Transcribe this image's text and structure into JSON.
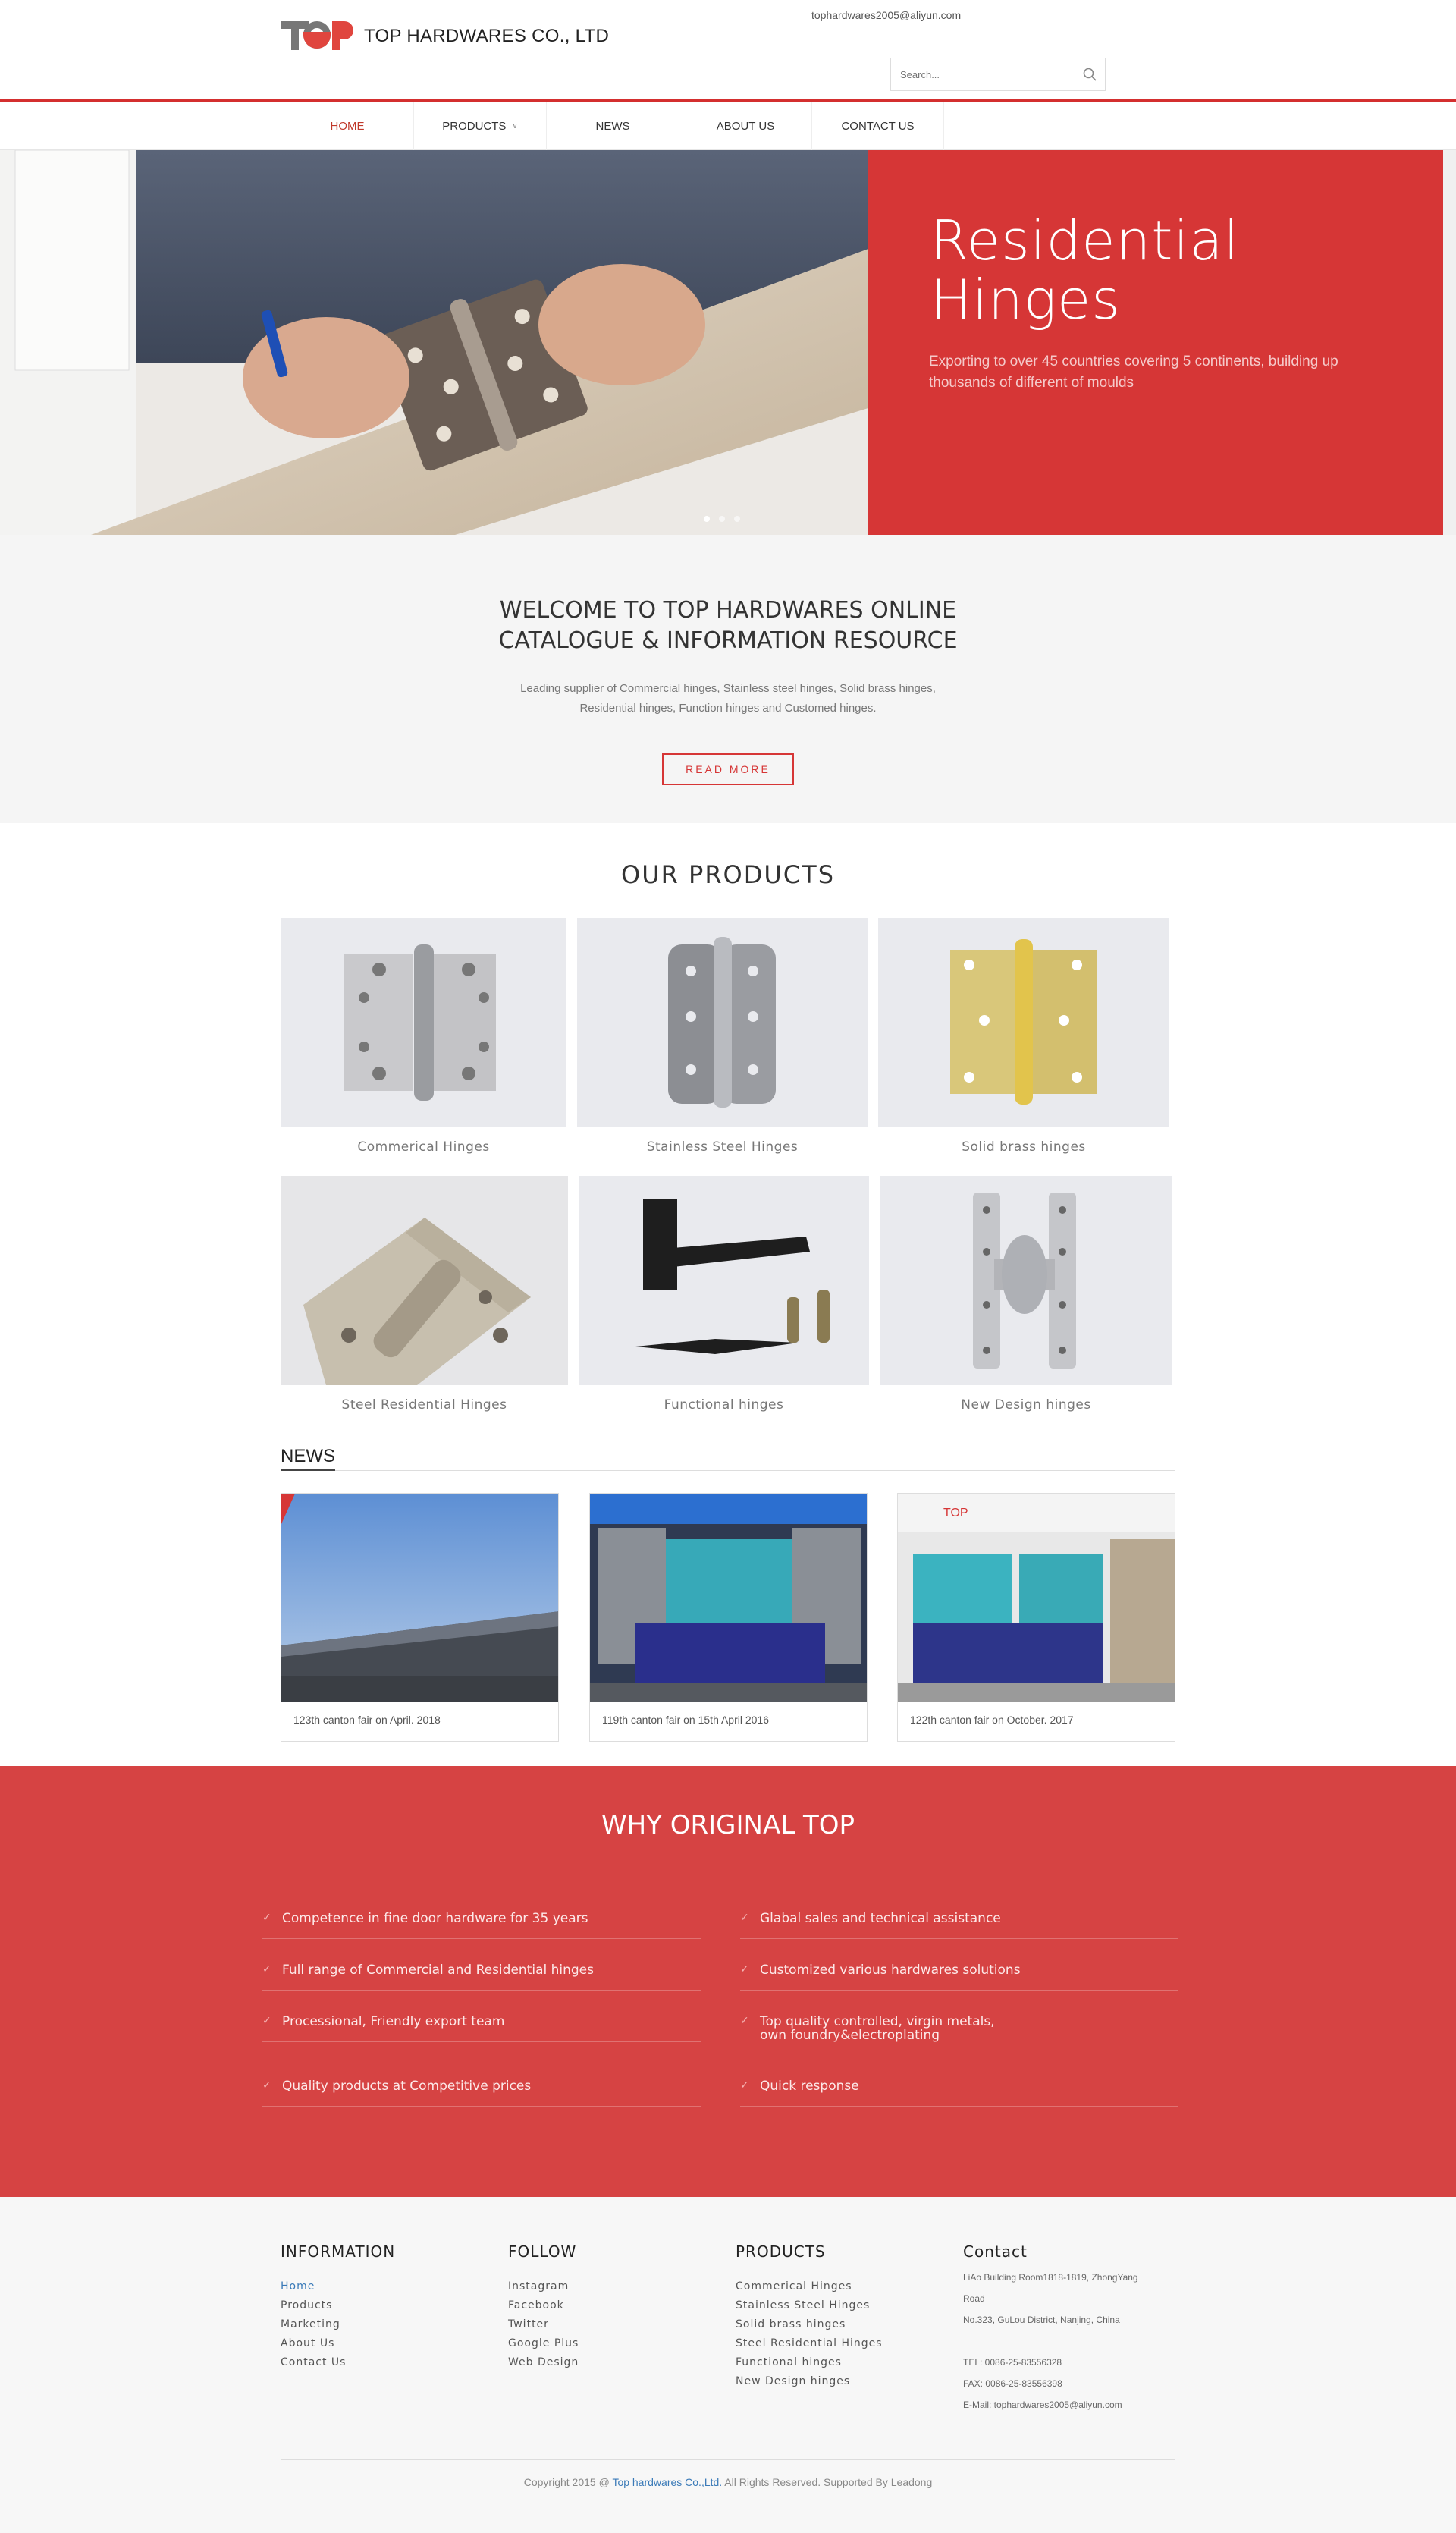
{
  "brand": {
    "logo_text": "TOP HARDWARES CO., LTD",
    "accent": "#d63636",
    "link": "#3a7ab8"
  },
  "header": {
    "email": "tophardwares2005@aliyun.com",
    "search_placeholder": "Search..."
  },
  "nav": [
    {
      "label": "HOME",
      "active": true
    },
    {
      "label": "PRODUCTS",
      "dropdown": true
    },
    {
      "label": "NEWS"
    },
    {
      "label": "ABOUT US"
    },
    {
      "label": "CONTACT US"
    }
  ],
  "hero": {
    "title_line1": "Residential",
    "title_line2": "Hinges",
    "subtitle": "Exporting to over 45 countries covering 5 continents, building up thousands of different of moulds",
    "slides": 3,
    "active_slide": 1
  },
  "welcome": {
    "title_line1": "WELCOME TO TOP HARDWARES ONLINE",
    "title_line2": "CATALOGUE & INFORMATION RESOURCE",
    "text": "Leading supplier of Commercial hinges, Stainless steel hinges, Solid brass hinges, Residential hinges, Function hinges and Customed hinges.",
    "button": "READ MORE"
  },
  "products": {
    "title": "OUR PRODUCTS",
    "items": [
      {
        "label": "Commerical Hinges"
      },
      {
        "label": "Stainless Steel Hinges"
      },
      {
        "label": "Solid brass hinges"
      },
      {
        "label": "Steel Residential Hinges"
      },
      {
        "label": "Functional hinges"
      },
      {
        "label": "New Design hinges"
      }
    ]
  },
  "news": {
    "title": "NEWS",
    "items": [
      {
        "caption": "123th canton fair on April. 2018"
      },
      {
        "caption": "119th canton fair on 15th April 2016"
      },
      {
        "caption": "122th canton fair on October. 2017"
      }
    ]
  },
  "why": {
    "title": "WHY ORIGINAL TOP",
    "left": [
      "Competence in fine door hardware for 35 years",
      "Full range of Commercial and Residential hinges",
      "Processional, Friendly export team",
      "Quality products at Competitive prices"
    ],
    "right": [
      "Glabal sales and technical assistance",
      "Customized various hardwares solutions",
      "Top quality controlled, virgin metals, own foundry&electroplating",
      "Quick response"
    ]
  },
  "footer": {
    "information": {
      "title": "INFORMATION",
      "links": [
        "Home",
        "Products",
        "Marketing",
        "About Us",
        "Contact Us"
      ]
    },
    "follow": {
      "title": "FOLLOW",
      "links": [
        "Instagram",
        "Facebook",
        "Twitter",
        "Google Plus",
        "Web Design"
      ]
    },
    "products": {
      "title": "PRODUCTS",
      "links": [
        "Commerical Hinges",
        "Stainless Steel Hinges",
        "Solid brass hinges",
        "Steel Residential Hinges",
        "Functional hinges",
        "New Design hinges"
      ]
    },
    "contact": {
      "title": "Contact",
      "addr1": "LiAo Building Room1818-1819, ZhongYang",
      "addr2": "Road",
      "addr3": "No.323, GuLou District, Nanjing, China",
      "tel": "TEL: 0086-25-83556328",
      "fax": "FAX: 0086-25-83556398",
      "email": "E-Mail: tophardwares2005@aliyun.com"
    },
    "copyright_pre": "Copyright 2015 @ ",
    "copyright_link": "Top hardwares Co.,Ltd.",
    "copyright_post": " All Rights Reserved. Supported By Leadong"
  }
}
